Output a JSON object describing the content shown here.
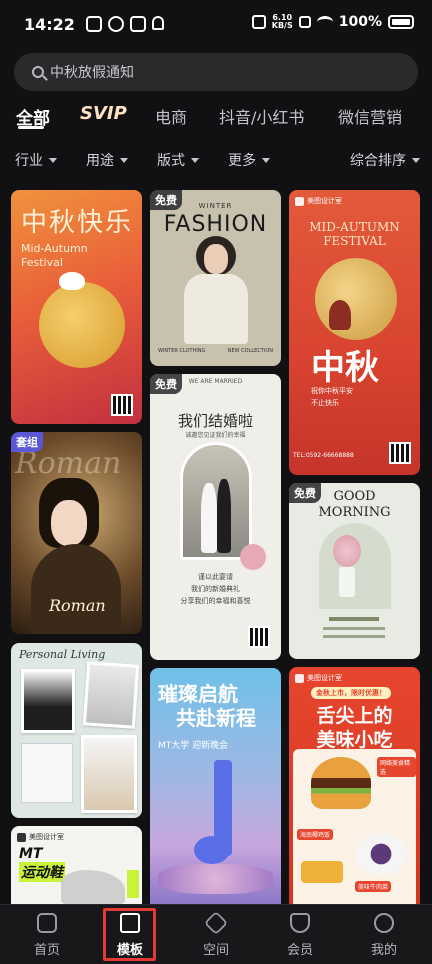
{
  "status_bar": {
    "time": "14:22",
    "net_speed": "6.10",
    "net_unit": "KB/S",
    "battery": "100%"
  },
  "search": {
    "placeholder": "中秋放假通知"
  },
  "tabs": [
    {
      "label": "全部"
    },
    {
      "label": "SVIP"
    },
    {
      "label": "电商"
    },
    {
      "label": "抖音/小红书"
    },
    {
      "label": "微信营销"
    }
  ],
  "filters": [
    {
      "label": "行业"
    },
    {
      "label": "用途"
    },
    {
      "label": "版式"
    },
    {
      "label": "更多"
    },
    {
      "label": "综合排序"
    }
  ],
  "cards": {
    "c1": {
      "title": "中秋快乐",
      "subtitle": "Mid-Autumn",
      "subtitle2": "Festival"
    },
    "c2": {
      "badge": "免费",
      "top": "WINTER",
      "title": "FASHION",
      "left_foot": "WINTER CLOTHING",
      "right_foot": "NEW COLLECTION"
    },
    "c3": {
      "brand": "美图设计室",
      "title": "MID-AUTUMN",
      "title2": "FESTIVAL",
      "big": "中秋",
      "line1": "祝你中秋平安",
      "line2": "不止快乐",
      "phone": "TEL:0592-66668888"
    },
    "c4": {
      "badge": "免费",
      "top": "WE ARE MARRIED",
      "title": "我们结婚啦",
      "sub": "诚邀您见证我们的幸福",
      "line1": "谨以此宴请",
      "line2": "我们的新婚典礼",
      "line3": "分享我们的幸福和喜悦"
    },
    "c5": {
      "badge": "套组",
      "bg_word": "Roman",
      "script": "Roman"
    },
    "c6": {
      "badge": "免费",
      "title": "GOOD",
      "title2": "MORNING"
    },
    "c7": {
      "title": "Personal Living"
    },
    "c8": {
      "title": "璀璨启航",
      "title2": "共赴新程",
      "sub": "MT大学 迎新晚会"
    },
    "c9": {
      "brand": "美图设计室",
      "pill": "金秋上市，限时优惠！",
      "title": "舌尖上的",
      "title2": "美味小吃",
      "tag": "网络美食精选",
      "tag2": "海南椰鸡饭",
      "tag3": "美味牛肉菜"
    },
    "c10": {
      "brand": "美图设计室",
      "title": "MT",
      "title2": "运动鞋"
    }
  },
  "bottom_nav": [
    {
      "label": "首页",
      "icon": "home-icon"
    },
    {
      "label": "模板",
      "icon": "template-icon"
    },
    {
      "label": "空间",
      "icon": "cube-icon"
    },
    {
      "label": "会员",
      "icon": "diamond-icon"
    },
    {
      "label": "我的",
      "icon": "smile-icon"
    }
  ],
  "colors": {
    "background": "#111113",
    "highlight": "#e53935"
  }
}
